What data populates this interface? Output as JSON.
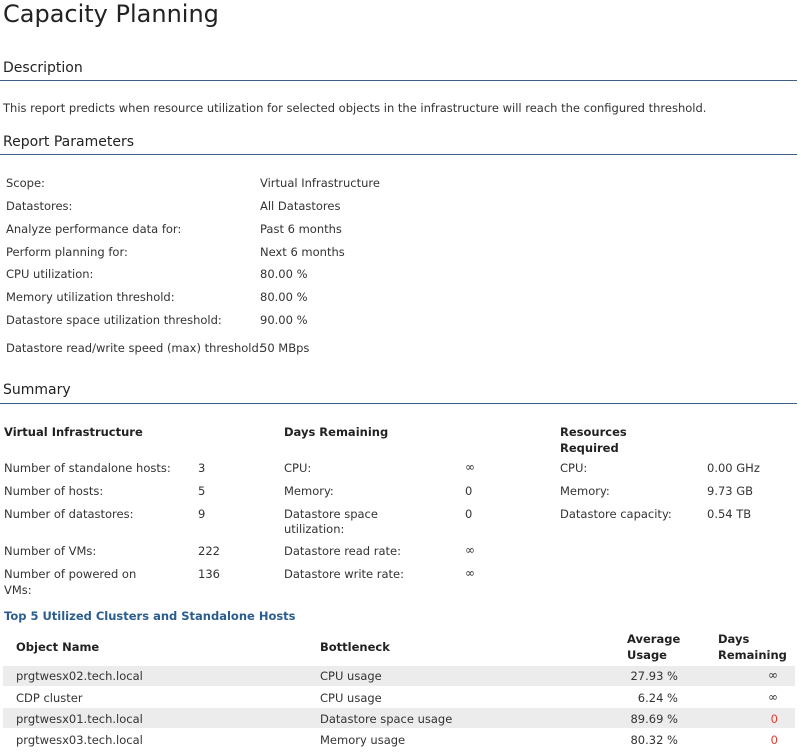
{
  "page": {
    "title": "Capacity Planning"
  },
  "description": {
    "heading": "Description",
    "text": "This report predicts when resource utilization for selected objects in the infrastructure will reach the configured threshold."
  },
  "parameters": {
    "heading": "Report Parameters",
    "rows": [
      {
        "label": "Scope:",
        "value": "Virtual Infrastructure"
      },
      {
        "label": "Datastores:",
        "value": "All Datastores"
      },
      {
        "label": "Analyze performance data for:",
        "value": "Past 6 months"
      },
      {
        "label": "Perform planning for:",
        "value": "Next 6 months"
      },
      {
        "label": "CPU utilization:",
        "value": "80.00 %"
      },
      {
        "label": "Memory utilization threshold:",
        "value": "80.00 %"
      },
      {
        "label": "Datastore space utilization threshold:",
        "value": "90.00 %"
      },
      {
        "label": "Datastore read/write speed (max) threshold:",
        "value": "50 MBps"
      }
    ]
  },
  "summary": {
    "heading": "Summary",
    "vi": {
      "title": "Virtual Infrastructure",
      "rows": [
        {
          "label": "Number of standalone hosts:",
          "value": "3"
        },
        {
          "label": "Number of hosts:",
          "value": "5"
        },
        {
          "label": "Number of datastores:",
          "value": "9"
        },
        {
          "label": "Number of VMs:",
          "value": "222"
        },
        {
          "label1": "Number of powered on",
          "label2": "VMs:",
          "value": "136"
        }
      ]
    },
    "days": {
      "title": "Days Remaining",
      "rows": [
        {
          "label": "CPU:",
          "value": "∞"
        },
        {
          "label": "Memory:",
          "value": "0"
        },
        {
          "label1": "Datastore space",
          "label2": "utilization:",
          "value": "0"
        },
        {
          "label": "Datastore read rate:",
          "value": "∞"
        },
        {
          "label": "Datastore write rate:",
          "value": "∞"
        }
      ]
    },
    "resources": {
      "title1": "Resources",
      "title2": "Required",
      "rows": [
        {
          "label": "CPU:",
          "value": "0.00 GHz"
        },
        {
          "label": "Memory:",
          "value": "9.73 GB"
        },
        {
          "label": "Datastore capacity:",
          "value": "0.54 TB"
        }
      ]
    }
  },
  "top5": {
    "title": "Top 5 Utilized Clusters and Standalone Hosts",
    "headers": {
      "object": "Object Name",
      "bottleneck": "Bottleneck",
      "avg1": "Average",
      "avg2": "Usage",
      "days1": "Days",
      "days2": "Remaining"
    },
    "rows": [
      {
        "name": "prgtwesx02.tech.local",
        "bottleneck": "CPU usage",
        "usage": "27.93 %",
        "days": "∞"
      },
      {
        "name": "CDP cluster",
        "bottleneck": "CPU usage",
        "usage": "6.24 %",
        "days": "∞"
      },
      {
        "name": "prgtwesx01.tech.local",
        "bottleneck": "Datastore space usage",
        "usage": "89.69 %",
        "days": "0"
      },
      {
        "name": "prgtwesx03.tech.local",
        "bottleneck": "Memory usage",
        "usage": "80.32 %",
        "days": "0"
      }
    ]
  },
  "colors": {
    "rule": "#3b5f87",
    "link": "#2b5d8e",
    "alert": "#e03c31",
    "row_shade": "#ececec"
  }
}
